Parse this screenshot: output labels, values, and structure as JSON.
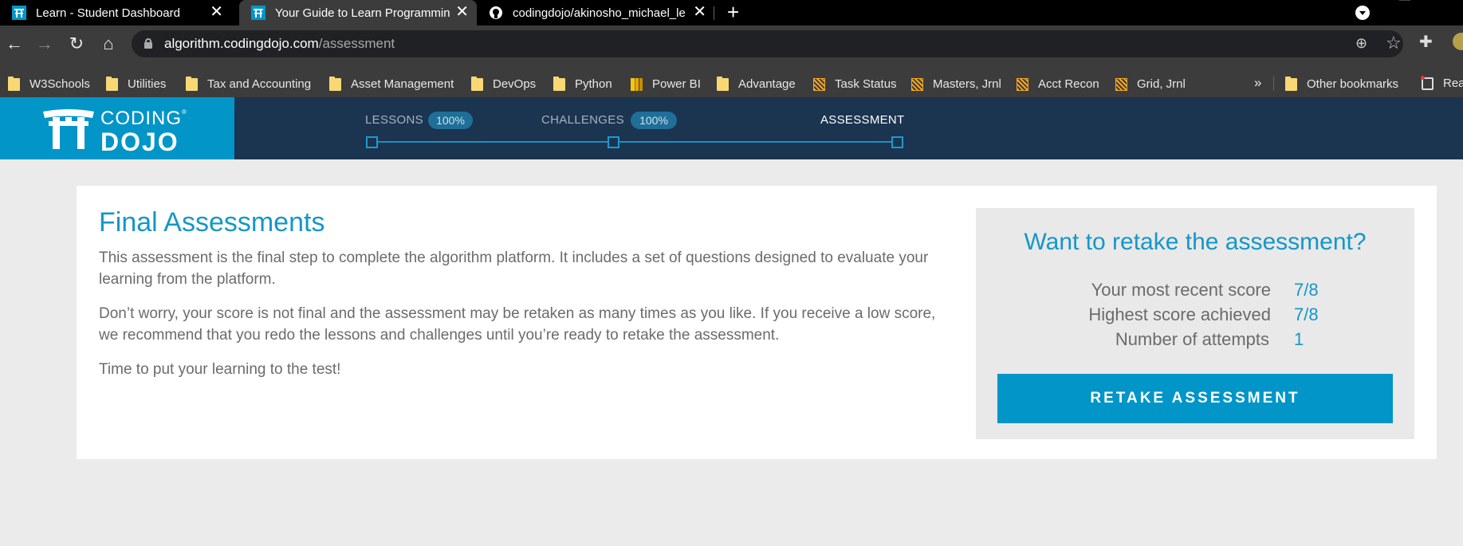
{
  "browser": {
    "tabs": [
      {
        "title": "Learn - Student Dashboard",
        "icon": "coding-dojo-favicon",
        "active": false
      },
      {
        "title": "Your Guide to Learn Programmin",
        "icon": "coding-dojo-favicon",
        "active": true
      },
      {
        "title": "codingdojo/akinosho_michael_le",
        "icon": "github-icon",
        "active": false
      }
    ],
    "url_domain": "algorithm.codingdojo.com",
    "url_path": "/assessment",
    "bookmarks": [
      {
        "label": "W3Schools",
        "icon": "folder-icon"
      },
      {
        "label": "Utilities",
        "icon": "folder-icon"
      },
      {
        "label": "Tax and Accounting",
        "icon": "folder-icon"
      },
      {
        "label": "Asset Management",
        "icon": "folder-icon"
      },
      {
        "label": "DevOps",
        "icon": "folder-icon"
      },
      {
        "label": "Python",
        "icon": "folder-icon"
      },
      {
        "label": "Power BI",
        "icon": "power-bi-icon"
      },
      {
        "label": "Advantage",
        "icon": "folder-icon"
      },
      {
        "label": "Task Status",
        "icon": "sheet-icon"
      },
      {
        "label": "Masters, Jrnl",
        "icon": "sheet-icon"
      },
      {
        "label": "Acct Recon",
        "icon": "sheet-icon"
      },
      {
        "label": "Grid, Jrnl",
        "icon": "sheet-icon"
      }
    ],
    "bookmarks_overflow": "»",
    "other_bookmarks": "Other bookmarks",
    "reading_list": "Rea"
  },
  "header": {
    "logo_line1": "CODING",
    "logo_line2": "DOJO",
    "steps": [
      {
        "label": "LESSONS",
        "badge": "100%"
      },
      {
        "label": "CHALLENGES",
        "badge": "100%"
      },
      {
        "label": "ASSESSMENT",
        "badge": null
      }
    ]
  },
  "main": {
    "title": "Final Assessments",
    "paragraphs": [
      "This assessment is the final step to complete the algorithm platform. It includes a set of questions designed to evaluate your learning from the platform.",
      "Don’t worry, your score is not final and the assessment may be retaken as many times as you like. If you receive a low score, we recommend that you redo the lessons and challenges until you’re ready to retake the assessment.",
      "Time to put your learning to the test!"
    ]
  },
  "retake": {
    "title": "Want to retake the assessment?",
    "stats": [
      {
        "label": "Your most recent score",
        "value": "7/8"
      },
      {
        "label": "Highest score achieved",
        "value": "7/8"
      },
      {
        "label": "Number of attempts",
        "value": "1"
      }
    ],
    "button_label": "RETAKE ASSESSMENT"
  },
  "colors": {
    "accent": "#1597c7",
    "button": "#0195c8",
    "header_bg": "#1b3450"
  }
}
